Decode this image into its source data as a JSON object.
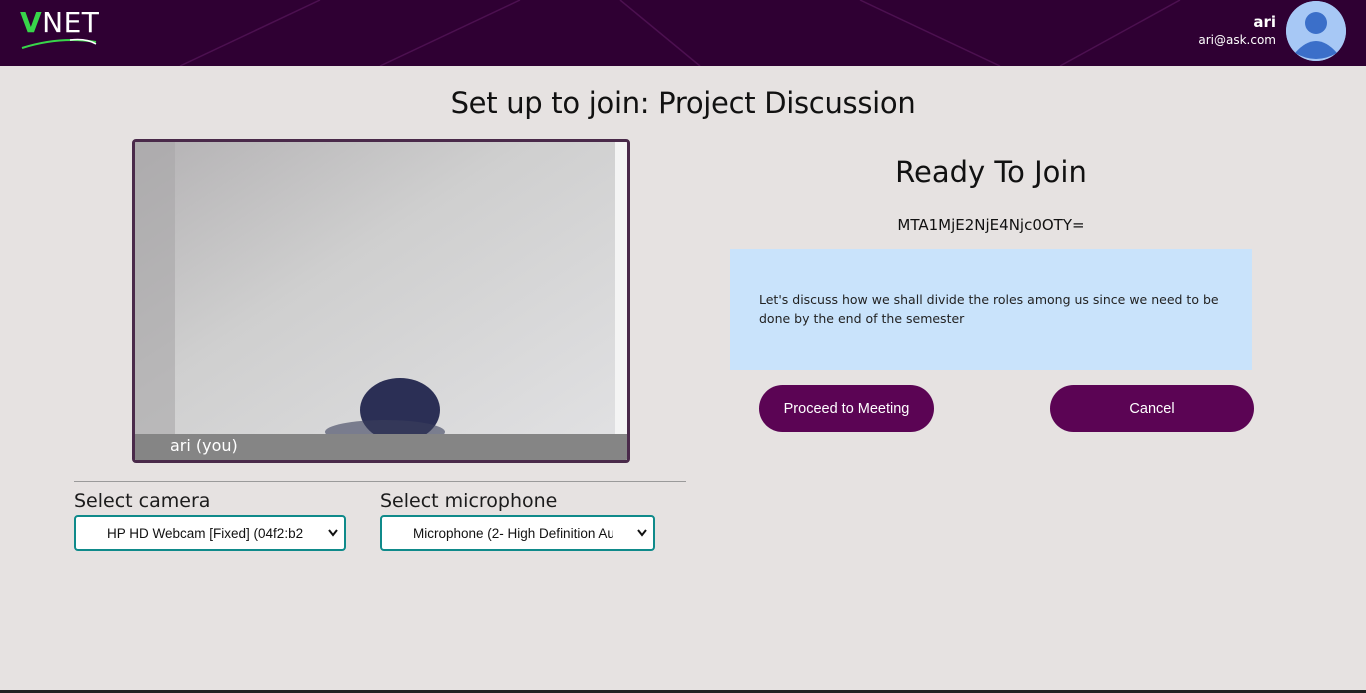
{
  "header": {
    "logo": {
      "v": "V",
      "rest": "NET"
    },
    "user": {
      "name": "ari",
      "email": "ari@ask.com"
    },
    "icons": {
      "avatar": "user-avatar-icon"
    }
  },
  "page": {
    "title": "Set up to join: Project Discussion"
  },
  "preview": {
    "caption": "ari (you)"
  },
  "devices": {
    "camera_label": "Select camera",
    "camera_value": "HP HD Webcam [Fixed] (04f2:b2",
    "microphone_label": "Select microphone",
    "microphone_value": "Microphone (2- High Definition Au"
  },
  "meeting": {
    "status": "Ready To Join",
    "id": "MTA1MjE2NjE4Njc0OTY=",
    "description": "Let's discuss how we shall divide the roles among us since we need to be done by the end of the semester"
  },
  "actions": {
    "proceed_label": "Proceed to Meeting",
    "cancel_label": "Cancel"
  },
  "colors": {
    "header_bg": "#2f0033",
    "accent_button": "#5b0454",
    "description_bg": "#c9e3fb",
    "select_border": "#0f8a8a",
    "logo_green": "#38d54a"
  }
}
